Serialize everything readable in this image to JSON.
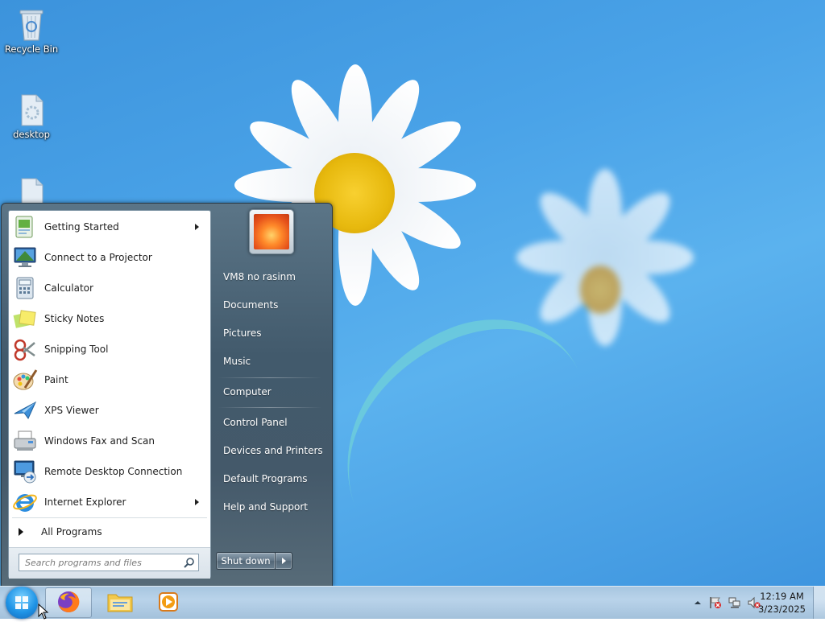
{
  "desktop": {
    "icons": [
      {
        "label": "Recycle Bin",
        "icon": "recycle-bin-icon"
      },
      {
        "label": "desktop",
        "icon": "generic-file-icon"
      }
    ]
  },
  "start_menu": {
    "programs": [
      {
        "label": "Getting Started",
        "icon": "getting-started-icon",
        "has_submenu": true
      },
      {
        "label": "Connect to a Projector",
        "icon": "projector-icon"
      },
      {
        "label": "Calculator",
        "icon": "calculator-icon"
      },
      {
        "label": "Sticky Notes",
        "icon": "sticky-notes-icon"
      },
      {
        "label": "Snipping Tool",
        "icon": "snipping-tool-icon"
      },
      {
        "label": "Paint",
        "icon": "paint-icon"
      },
      {
        "label": "XPS Viewer",
        "icon": "xps-viewer-icon"
      },
      {
        "label": "Windows Fax and Scan",
        "icon": "fax-scan-icon"
      },
      {
        "label": "Remote Desktop Connection",
        "icon": "remote-desktop-icon"
      },
      {
        "label": "Internet Explorer",
        "icon": "internet-explorer-icon",
        "has_submenu": true
      }
    ],
    "all_programs_label": "All Programs",
    "search_placeholder": "Search programs and files",
    "right_items": [
      {
        "label": "VM8 no rasinm"
      },
      {
        "label": "Documents"
      },
      {
        "label": "Pictures"
      },
      {
        "label": "Music"
      },
      {
        "label": "Computer"
      },
      {
        "label": "Control Panel"
      },
      {
        "label": "Devices and Printers"
      },
      {
        "label": "Default Programs"
      },
      {
        "label": "Help and Support"
      }
    ],
    "shutdown_label": "Shut down"
  },
  "taskbar": {
    "pinned": [
      {
        "name": "Firefox",
        "icon": "firefox-icon"
      },
      {
        "name": "File Explorer",
        "icon": "folder-icon"
      },
      {
        "name": "Windows Media Player",
        "icon": "media-player-icon"
      }
    ],
    "clock": {
      "time": "12:19 AM",
      "date": "3/23/2025"
    }
  },
  "colors": {
    "desktop_blue": "#4aa3e8",
    "menu_dark": "#44596a",
    "taskbar": "#b9d3ea"
  }
}
